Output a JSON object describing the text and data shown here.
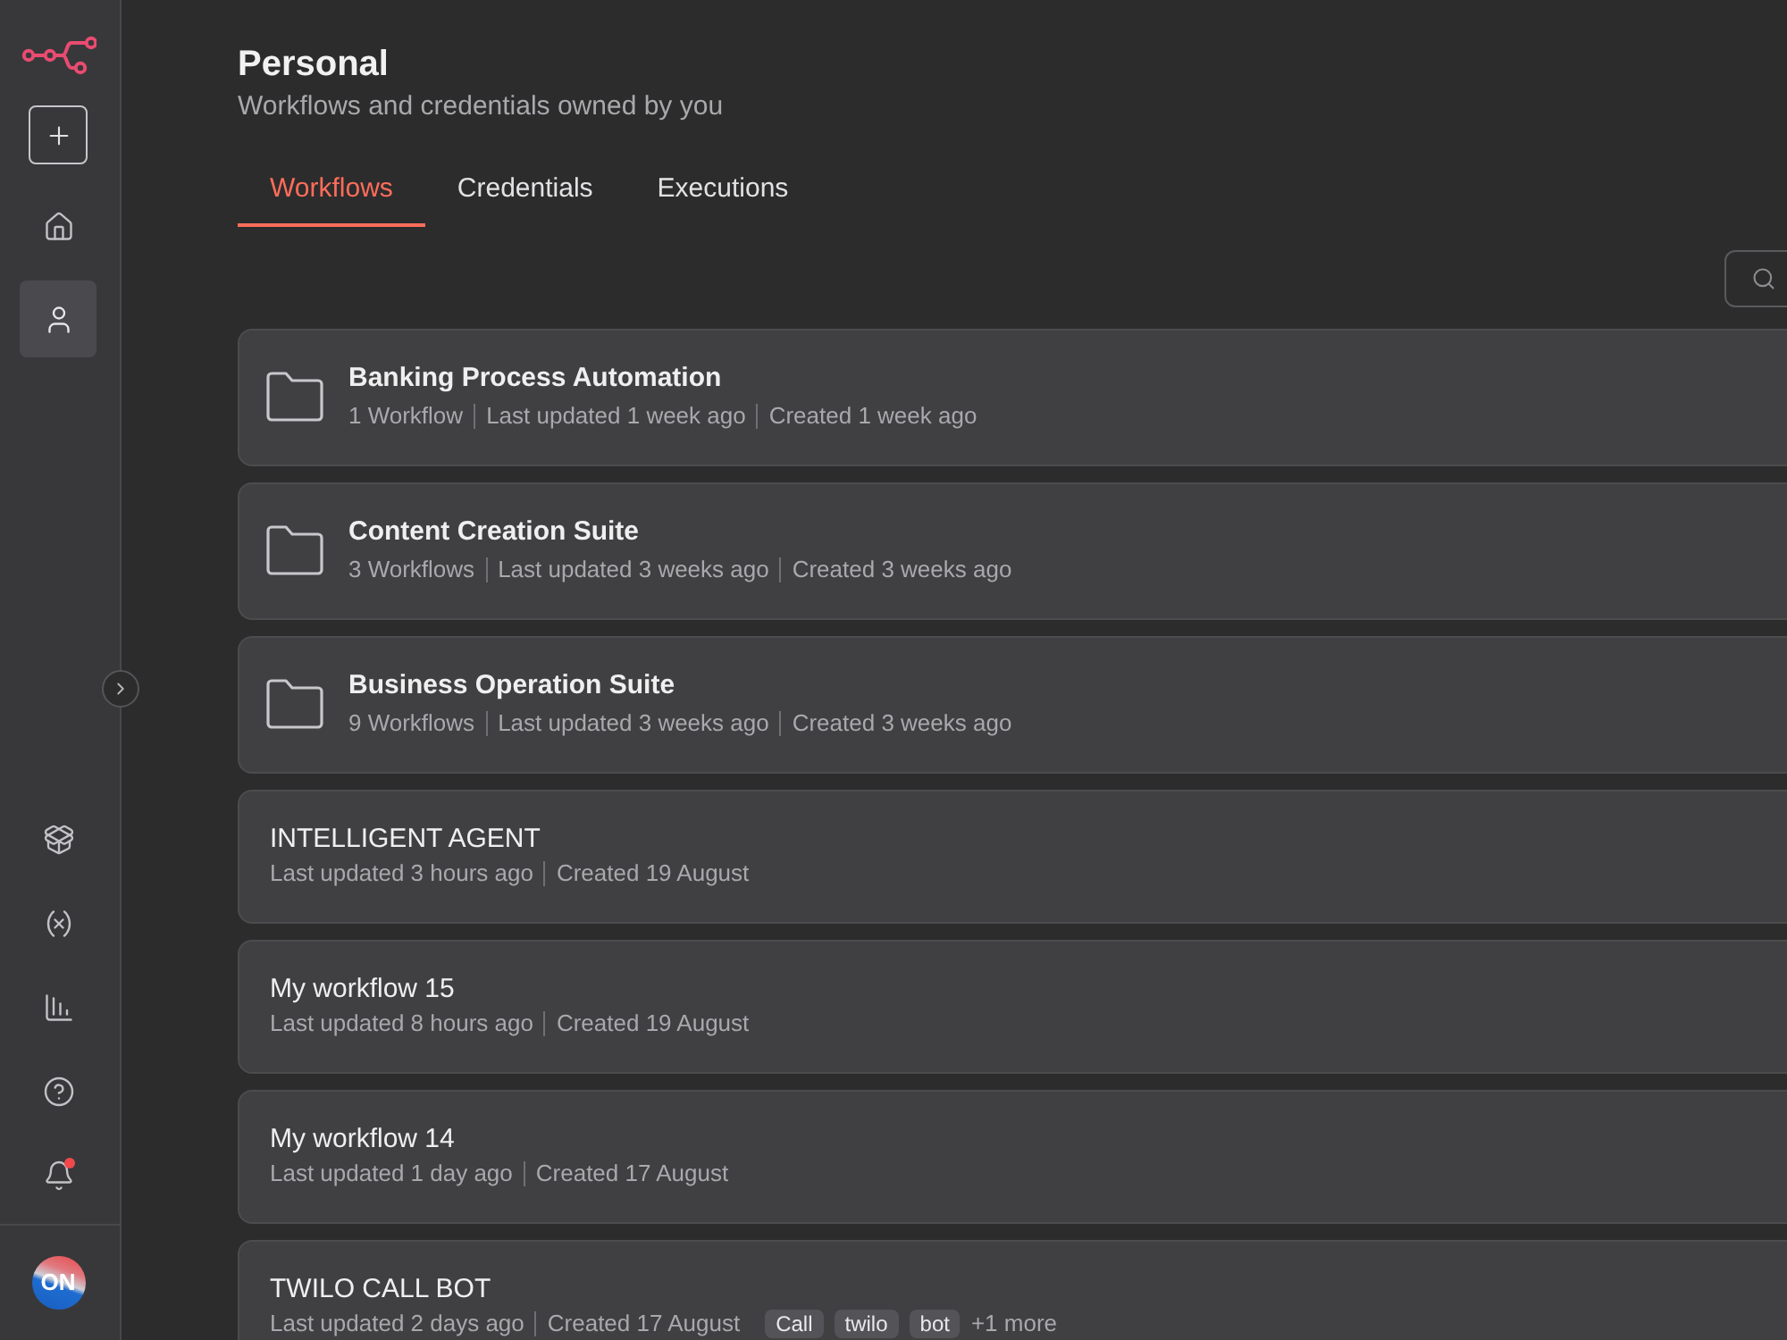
{
  "sidebar": {
    "nav": [
      {
        "kind": "home",
        "selected": false
      },
      {
        "kind": "personal",
        "selected": true
      }
    ],
    "bottom": [
      {
        "kind": "templates",
        "notification": false
      },
      {
        "kind": "variables",
        "notification": false
      },
      {
        "kind": "insights",
        "notification": false
      },
      {
        "kind": "help",
        "notification": false
      },
      {
        "kind": "notifications",
        "notification": true
      }
    ],
    "user": {
      "initials": "ON"
    }
  },
  "header": {
    "title": "Personal",
    "subtitle": "Workflows and credentials owned by you"
  },
  "tabs": [
    {
      "label": "Workflows",
      "selected": true
    },
    {
      "label": "Credentials",
      "selected": false
    },
    {
      "label": "Executions",
      "selected": false
    }
  ],
  "items": [
    {
      "kind": "folder",
      "name": "Banking Process Automation",
      "meta": [
        "1 Workflow",
        "Last updated 1 week ago",
        "Created 1 week ago"
      ]
    },
    {
      "kind": "folder",
      "name": "Content Creation Suite",
      "meta": [
        "3 Workflows",
        "Last updated 3 weeks ago",
        "Created 3 weeks ago"
      ]
    },
    {
      "kind": "folder",
      "name": "Business Operation Suite",
      "meta": [
        "9 Workflows",
        "Last updated 3 weeks ago",
        "Created 3 weeks ago"
      ]
    },
    {
      "kind": "workflow",
      "name": "INTELLIGENT AGENT",
      "meta": [
        "Last updated 3 hours ago",
        "Created 19 August"
      ]
    },
    {
      "kind": "workflow",
      "name": "My workflow 15",
      "meta": [
        "Last updated 8 hours ago",
        "Created 19 August"
      ]
    },
    {
      "kind": "workflow",
      "name": "My workflow 14",
      "meta": [
        "Last updated 1 day ago",
        "Created 17 August"
      ]
    },
    {
      "kind": "workflow",
      "name": "TWILO CALL BOT",
      "meta": [
        "Last updated 2 days ago",
        "Created 17 August"
      ],
      "tags": [
        "Call",
        "twilo",
        "bot"
      ],
      "more_tags": "+1 more"
    }
  ]
}
